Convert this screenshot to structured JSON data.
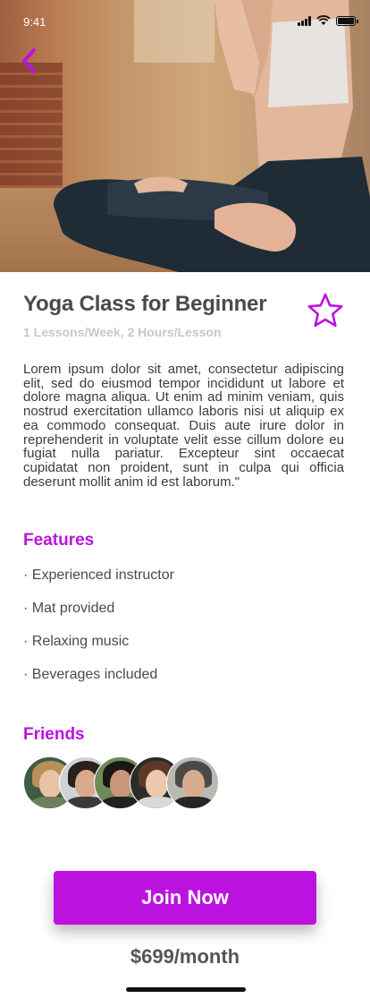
{
  "status_bar": {
    "time": "9:41",
    "icons": [
      "signal-icon",
      "wifi-icon",
      "battery-icon"
    ]
  },
  "header": {
    "back_icon": "chevron-left-icon",
    "hero_image": "woman-meditating-yoga-pose"
  },
  "class": {
    "title": "Yoga Class for Beginner",
    "schedule": "1 Lessons/Week, 2 Hours/Lesson",
    "favorite_icon": "star-outline-icon",
    "description": "Lorem ipsum dolor sit amet, consectetur adipiscing elit, sed do eiusmod tempor incididunt ut labore et dolore magna aliqua. Ut enim ad minim veniam, quis nostrud exercitation ullamco laboris nisi ut aliquip ex ea commodo consequat. Duis aute irure dolor in reprehenderit in voluptate velit esse cillum dolore eu fugiat nulla pariatur. Excepteur sint occaecat cupidatat non proident, sunt in culpa qui officia deserunt mollit anim id est laborum.\""
  },
  "features": {
    "heading": "Features",
    "items": [
      "· Experienced instructor",
      "· Mat provided",
      "· Relaxing music",
      "· Beverages included"
    ]
  },
  "friends": {
    "heading": "Friends",
    "count": 5
  },
  "cta": {
    "join_label": "Join Now",
    "price": "$699/month"
  },
  "colors": {
    "accent": "#bc12e0",
    "text": "#4a4a4a",
    "muted": "#c8c8c8"
  }
}
